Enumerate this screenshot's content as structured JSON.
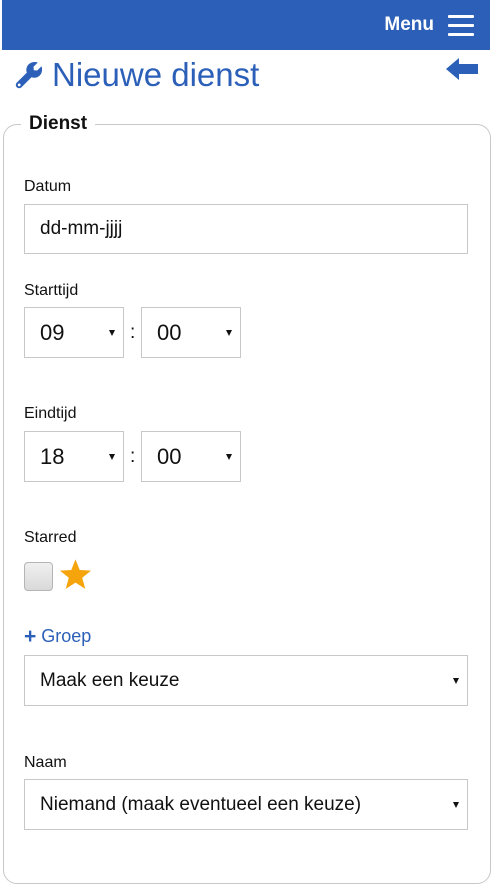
{
  "header": {
    "menu_label": "Menu"
  },
  "page": {
    "title": "Nieuwe dienst"
  },
  "form": {
    "legend": "Dienst",
    "datum": {
      "label": "Datum",
      "placeholder": "dd-mm-jjjj"
    },
    "starttijd": {
      "label": "Starttijd",
      "hour": "09",
      "minute": "00",
      "separator": ":"
    },
    "eindtijd": {
      "label": "Eindtijd",
      "hour": "18",
      "minute": "00",
      "separator": ":"
    },
    "starred": {
      "label": "Starred",
      "checked": false
    },
    "groep": {
      "link_icon": "+",
      "link_label": "Groep",
      "selected": "Maak een keuze"
    },
    "naam": {
      "label": "Naam",
      "selected": "Niemand (maak eventueel een keuze)"
    }
  },
  "colors": {
    "brand": "#2b5fb8",
    "star": "#f5a40c",
    "border": "#c8c8c8"
  },
  "icons": {
    "menu": "hamburger-icon",
    "title": "wrench-icon",
    "back": "arrow-left-icon",
    "starred": "star-icon"
  }
}
